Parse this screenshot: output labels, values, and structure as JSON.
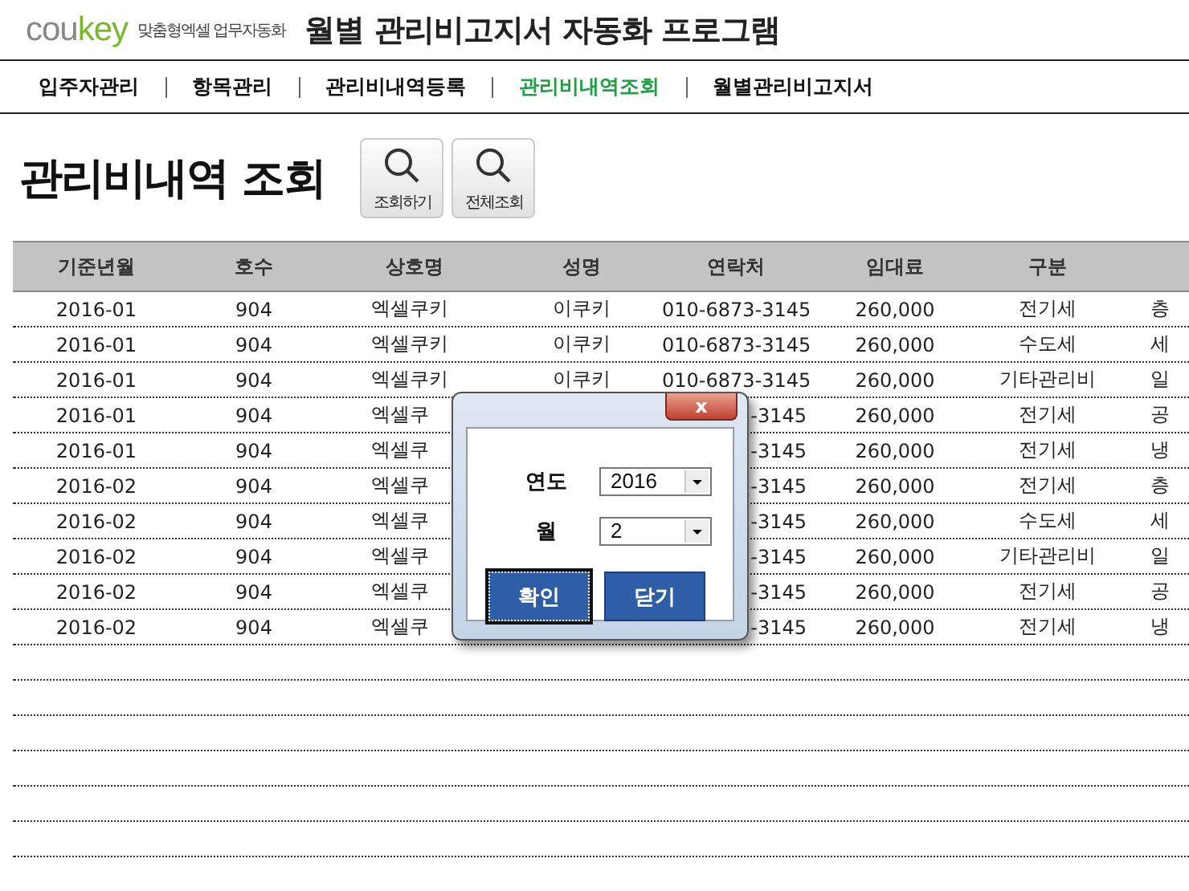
{
  "header": {
    "logo": {
      "lead": "cou",
      "accent": "key"
    },
    "tagline": "맞춤형엑셀 업무자동화",
    "title": "월별 관리비고지서 자동화 프로그램"
  },
  "nav": [
    {
      "label": "입주자관리",
      "selected": false
    },
    {
      "label": "항목관리",
      "selected": false
    },
    {
      "label": "관리비내역등록",
      "selected": false
    },
    {
      "label": "관리비내역조회",
      "selected": true
    },
    {
      "label": "월별관리비고지서",
      "selected": false
    }
  ],
  "page_title": "관리비내역 조회",
  "toolbar": [
    {
      "label": "조회하기"
    },
    {
      "label": "전체조회"
    }
  ],
  "table": {
    "columns": [
      "기준년월",
      "호수",
      "상호명",
      "성명",
      "연락처",
      "임대료",
      "구분"
    ],
    "rows": [
      {
        "cells": [
          "2016-01",
          "904",
          "엑셀쿠키",
          "이쿠키",
          "010-6873-3145",
          "260,000",
          "전기세",
          "층"
        ]
      },
      {
        "cells": [
          "2016-01",
          "904",
          "엑셀쿠키",
          "이쿠키",
          "010-6873-3145",
          "260,000",
          "수도세",
          "세"
        ]
      },
      {
        "cells": [
          "2016-01",
          "904",
          "엑셀쿠키",
          "이쿠키",
          "010-6873-3145",
          "260,000",
          "기타관리비",
          "일"
        ]
      },
      {
        "cells": [
          "2016-01",
          "904",
          "엑셀쿠",
          "",
          "-3145",
          "260,000",
          "전기세",
          "공"
        ]
      },
      {
        "cells": [
          "2016-01",
          "904",
          "엑셀쿠",
          "",
          "-3145",
          "260,000",
          "전기세",
          "냉"
        ]
      },
      {
        "cells": [
          "2016-02",
          "904",
          "엑셀쿠",
          "",
          "-3145",
          "260,000",
          "전기세",
          "층"
        ]
      },
      {
        "cells": [
          "2016-02",
          "904",
          "엑셀쿠",
          "",
          "-3145",
          "260,000",
          "수도세",
          "세"
        ]
      },
      {
        "cells": [
          "2016-02",
          "904",
          "엑셀쿠",
          "",
          "-3145",
          "260,000",
          "기타관리비",
          "일"
        ]
      },
      {
        "cells": [
          "2016-02",
          "904",
          "엑셀쿠",
          "",
          "-3145",
          "260,000",
          "전기세",
          "공"
        ]
      },
      {
        "cells": [
          "2016-02",
          "904",
          "엑셀쿠",
          "",
          "-3145",
          "260,000",
          "전기세",
          "냉"
        ]
      }
    ]
  },
  "dialog": {
    "close": "x",
    "fields": [
      {
        "label": "연도",
        "value": "2016"
      },
      {
        "label": "월",
        "value": "2"
      }
    ],
    "buttons": [
      {
        "label": "확인",
        "focused": true
      },
      {
        "label": "닫기",
        "focused": false
      }
    ]
  }
}
